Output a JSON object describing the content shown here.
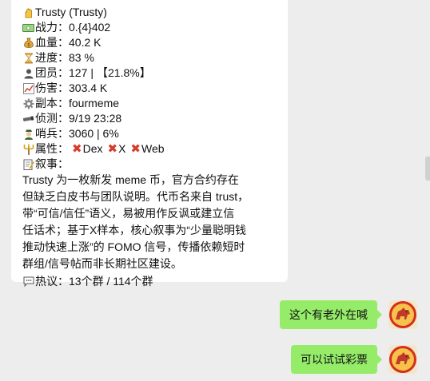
{
  "card": {
    "title": "Trusty (Trusty)",
    "fields": [
      {
        "icon": "cash-icon",
        "label": "战力：",
        "value": "0.{4}402"
      },
      {
        "icon": "money-bag-icon",
        "label": "血量：",
        "value": "40.2 K"
      },
      {
        "icon": "hourglass-icon",
        "label": "进度：",
        "value": "83 %"
      },
      {
        "icon": "member-icon",
        "label": "团员：",
        "value": "127",
        "extra": "【21.8%】"
      },
      {
        "icon": "chart-icon",
        "label": "伤害：",
        "value": "303.4 K"
      },
      {
        "icon": "gear-icon",
        "label": "副本：",
        "value": "fourmeme"
      },
      {
        "icon": "telescope-icon",
        "label": "侦测：",
        "value": "9/19 23:28"
      },
      {
        "icon": "sentry-icon",
        "label": "哨兵：",
        "value": "3060 | 6%"
      }
    ],
    "attr_label": "属性：",
    "attrs": [
      "Dex",
      "X",
      "Web"
    ],
    "narrative_label": "叙事：",
    "narrative_text": "    Trusty 为一枚新发 meme 币，官方合约存在\n但缺乏白皮书与团队说明。代币名来自 trust，\n带“可信/信任”语义，易被用作反讽或建立信\n任话术；基于X样本，核心叙事为“少量聪明钱\n推动快速上涨”的 FOMO 信号，传播依赖短时\n群组/信号帖而非长期社区建设。",
    "heat_label": "热议：",
    "heat_value": "13个群 / 114个群"
  },
  "messages": [
    {
      "text": "这个有老外在喊"
    },
    {
      "text": "可以试试彩票"
    }
  ],
  "colors": {
    "background": "#ededed",
    "incoming_bubble": "#ffffff",
    "outgoing_bubble": "#95ec69",
    "cross": "#d83b2a"
  }
}
